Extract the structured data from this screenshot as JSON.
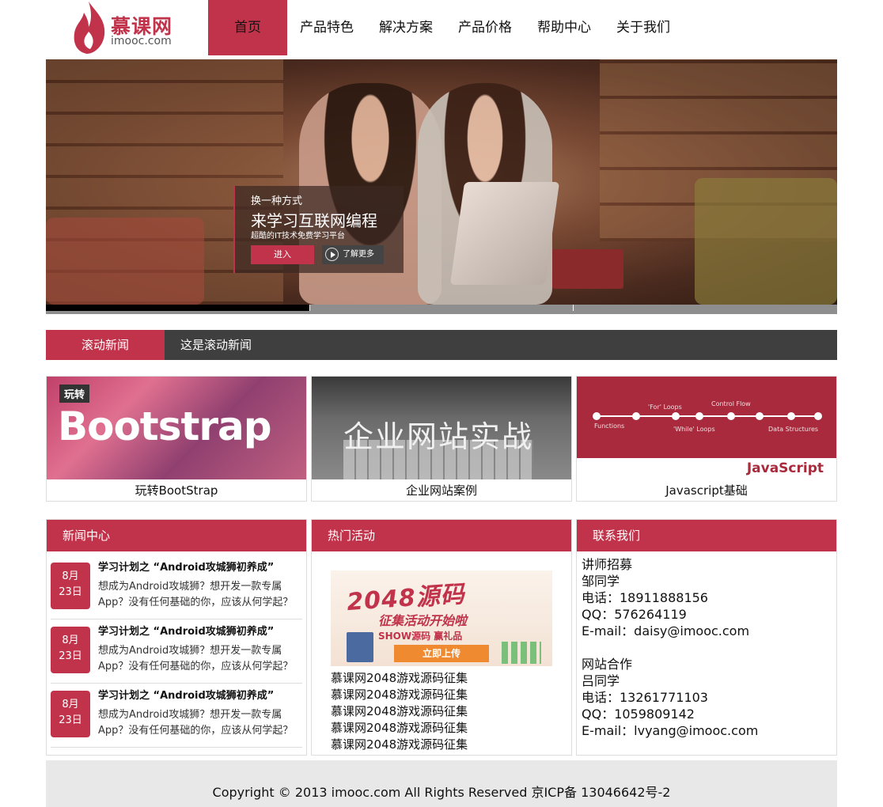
{
  "header": {
    "logo_cn": "慕课网",
    "logo_en": "imooc.com",
    "nav": [
      "首页",
      "产品特色",
      "解决方案",
      "产品价格",
      "帮助中心",
      "关于我们"
    ],
    "active_index": 0
  },
  "banner": {
    "subtitle": "换一种方式",
    "title": "来学习互联网编程",
    "description": "超酷的IT技术免费学习平台",
    "enter_label": "进入",
    "more_label": "了解更多",
    "slide_count": 3,
    "active_slide": 0,
    "progress": 0.333
  },
  "news_ticker": {
    "label": "滚动新闻",
    "text": "这是滚动新闻"
  },
  "courses": [
    {
      "title": "玩转BootStrap",
      "thumb_tag": "玩转",
      "thumb_text": "Bootstrap"
    },
    {
      "title": "企业网站案例",
      "thumb_text": "企业网站实战"
    },
    {
      "title": "Javascript基础",
      "thumb_text": "JavaScript",
      "thumb_labels": [
        "Functions",
        "'For' Loops",
        "'While' Loops",
        "Control Flow",
        "Data Structures"
      ]
    }
  ],
  "news_center": {
    "title": "新闻中心",
    "items": [
      {
        "month": "8月",
        "day": "23日",
        "title": "学习计划之 “Android攻城狮初养成”",
        "desc": "想成为Android攻城狮？想开发一款专属App？没有任何基础的你，应该从何学起？"
      },
      {
        "month": "8月",
        "day": "23日",
        "title": "学习计划之 “Android攻城狮初养成”",
        "desc": "想成为Android攻城狮？想开发一款专属App？没有任何基础的你，应该从何学起？"
      },
      {
        "month": "8月",
        "day": "23日",
        "title": "学习计划之 “Android攻城狮初养成”",
        "desc": "想成为Android攻城狮？想开发一款专属App？没有任何基础的你，应该从何学起？"
      }
    ]
  },
  "hot_events": {
    "title": "热门活动",
    "promo_big": "2048源码",
    "promo_sub": "征集活动开始啦",
    "promo_show": "SHOW源码 赢礼品",
    "promo_button": "立即上传",
    "links": [
      "慕课网2048游戏源码征集",
      "慕课网2048游戏源码征集",
      "慕课网2048游戏源码征集",
      "慕课网2048游戏源码征集",
      "慕课网2048游戏源码征集"
    ]
  },
  "contact": {
    "title": "联系我们",
    "groups": [
      {
        "heading": "讲师招募",
        "name": "邹同学",
        "phone": "电话：18911888156",
        "qq": "QQ：576264119",
        "email": "E-mail：daisy@imooc.com"
      },
      {
        "heading": "网站合作",
        "name": "吕同学",
        "phone": "电话：13261771103",
        "qq": "QQ：1059809142",
        "email": "E-mail：lvyang@imooc.com"
      }
    ]
  },
  "footer": {
    "text": "Copyright © 2013 imooc.com All Rights Reserved 京ICP备 13046642号-2"
  },
  "colors": {
    "brand_red": "#c1334a",
    "dark_bar": "#3f3f3f",
    "footer_bg": "#e8e8e8"
  }
}
